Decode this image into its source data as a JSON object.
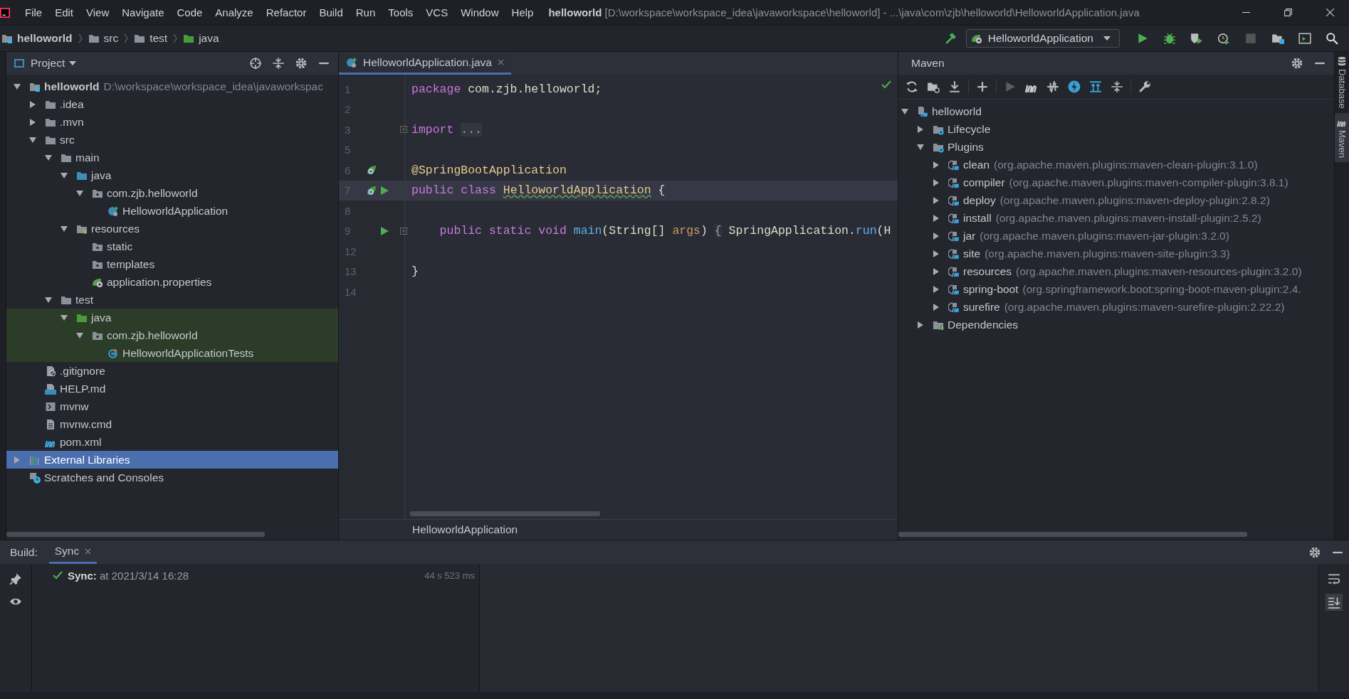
{
  "title_bar": {
    "menu": [
      "File",
      "Edit",
      "View",
      "Navigate",
      "Code",
      "Analyze",
      "Refactor",
      "Build",
      "Run",
      "Tools",
      "VCS",
      "Window",
      "Help"
    ],
    "title": "**helloworld** [D:\\workspace\\workspace_idea\\javaworkspace\\helloworld] - ...\\java\\com\\zjb\\helloworld\\HelloworldApplication.java"
  },
  "nav_bar": {
    "crumbs": [
      {
        "label": "helloworld",
        "kind": "module"
      },
      {
        "label": "src",
        "kind": "folder"
      },
      {
        "label": "test",
        "kind": "folder"
      },
      {
        "label": "java",
        "kind": "test-folder"
      }
    ],
    "run_config": "HelloworldApplication"
  },
  "project": {
    "title": "Project",
    "tree": [
      {
        "label": "helloworld",
        "detail": "D:\\workspace\\workspace_idea\\javaworkspac",
        "kind": "module",
        "expanded": true,
        "selected": false,
        "children": [
          {
            "label": ".idea",
            "kind": "folder",
            "expanded": false,
            "selected": false
          },
          {
            "label": ".mvn",
            "kind": "folder",
            "expanded": false,
            "selected": false
          },
          {
            "label": "src",
            "kind": "folder",
            "expanded": true,
            "selected": false,
            "children": [
              {
                "label": "main",
                "kind": "folder",
                "expanded": true,
                "selected": false,
                "children": [
                  {
                    "label": "java",
                    "kind": "source-folder",
                    "expanded": true,
                    "selected": false,
                    "children": [
                      {
                        "label": "com.zjb.helloworld",
                        "kind": "package",
                        "expanded": true,
                        "selected": false,
                        "children": [
                          {
                            "label": "HelloworldApplication",
                            "kind": "spring-class",
                            "selected": false
                          }
                        ]
                      }
                    ]
                  },
                  {
                    "label": "resources",
                    "kind": "resources-folder",
                    "expanded": true,
                    "selected": false,
                    "children": [
                      {
                        "label": "static",
                        "kind": "package",
                        "selected": false
                      },
                      {
                        "label": "templates",
                        "kind": "package",
                        "selected": false
                      },
                      {
                        "label": "application.properties",
                        "kind": "spring-config",
                        "selected": false
                      }
                    ]
                  }
                ]
              },
              {
                "label": "test",
                "kind": "folder",
                "expanded": true,
                "selected": false,
                "children": [
                  {
                    "label": "java",
                    "kind": "test-folder",
                    "expanded": true,
                    "selected": false,
                    "test_scope": true,
                    "children": [
                      {
                        "label": "com.zjb.helloworld",
                        "kind": "package",
                        "expanded": true,
                        "selected": false,
                        "children": [
                          {
                            "label": "HelloworldApplicationTests",
                            "kind": "test-class",
                            "selected": false
                          }
                        ]
                      }
                    ]
                  }
                ]
              }
            ]
          },
          {
            "label": ".gitignore",
            "kind": "ignore-file",
            "selected": false
          },
          {
            "label": "HELP.md",
            "kind": "markdown-file",
            "selected": false
          },
          {
            "label": "mvnw",
            "kind": "script-file",
            "selected": false
          },
          {
            "label": "mvnw.cmd",
            "kind": "text-file",
            "selected": false
          },
          {
            "label": "pom.xml",
            "kind": "maven-file",
            "selected": false
          }
        ]
      },
      {
        "label": "External Libraries",
        "kind": "libraries",
        "expanded": false,
        "selected": true
      },
      {
        "label": "Scratches and Consoles",
        "kind": "scratches",
        "selected": false
      }
    ]
  },
  "editor": {
    "tabs": [
      {
        "label": "HelloworldApplication.java",
        "selected": true
      }
    ],
    "lines": [
      {
        "number": "1",
        "current": false,
        "foldable": false,
        "spring_gutter": false,
        "run_button": false,
        "tokens": [
          {
            "text": "package",
            "kind": "keyword"
          },
          {
            "text": " com.zjb.helloworld;",
            "kind": "plain"
          }
        ]
      },
      {
        "number": "2",
        "current": false,
        "foldable": false,
        "spring_gutter": false,
        "run_button": false
      },
      {
        "number": "3",
        "current": false,
        "foldable": true,
        "spring_gutter": false,
        "run_button": false,
        "tokens": [
          {
            "text": "import ",
            "kind": "keyword"
          },
          {
            "text": "...",
            "kind": "folded"
          }
        ]
      },
      {
        "number": "5",
        "current": false,
        "foldable": false,
        "spring_gutter": false,
        "run_button": false
      },
      {
        "number": "6",
        "current": false,
        "foldable": false,
        "spring_gutter": true,
        "run_button": false,
        "tokens": [
          {
            "text": "@SpringBootApplication",
            "kind": "annotation"
          }
        ]
      },
      {
        "number": "7",
        "current": true,
        "foldable": false,
        "spring_gutter": true,
        "run_button": true,
        "tokens": [
          {
            "text": "public class ",
            "kind": "keyword"
          },
          {
            "text": "HelloworldApplication",
            "kind": "type",
            "warning": true
          },
          {
            "text": " {",
            "kind": "plain"
          }
        ]
      },
      {
        "number": "8",
        "current": false,
        "foldable": false,
        "spring_gutter": false,
        "run_button": false
      },
      {
        "number": "9",
        "current": false,
        "foldable": true,
        "spring_gutter": false,
        "run_button": true,
        "tokens": [
          {
            "text": "    public static void ",
            "kind": "keyword"
          },
          {
            "text": "main",
            "kind": "method"
          },
          {
            "text": "(String[] ",
            "kind": "plain"
          },
          {
            "text": "args",
            "kind": "param"
          },
          {
            "text": ") ",
            "kind": "plain"
          },
          {
            "text": "{",
            "kind": "brace"
          },
          {
            "text": " SpringApplication.",
            "kind": "plain"
          },
          {
            "text": "run",
            "kind": "method"
          },
          {
            "text": "(H",
            "kind": "plain"
          }
        ]
      },
      {
        "number": "12",
        "current": false,
        "foldable": false,
        "spring_gutter": false,
        "run_button": false
      },
      {
        "number": "13",
        "current": false,
        "foldable": false,
        "spring_gutter": false,
        "run_button": false,
        "tokens": [
          {
            "text": "}",
            "kind": "plain"
          }
        ]
      },
      {
        "number": "14",
        "current": false,
        "foldable": false,
        "spring_gutter": false,
        "run_button": false
      }
    ],
    "breadcrumb": "HelloworldApplication"
  },
  "maven": {
    "title": "Maven",
    "tree": [
      {
        "label": "helloworld",
        "kind": "maven-project",
        "expanded": true,
        "children": [
          {
            "label": "Lifecycle",
            "kind": "lifecycle",
            "expanded": false
          },
          {
            "label": "Plugins",
            "kind": "lifecycle",
            "expanded": true,
            "children": [
              {
                "label": "clean",
                "detail": "(org.apache.maven.plugins:maven-clean-plugin:3.1.0)",
                "kind": "plugin",
                "expanded": false
              },
              {
                "label": "compiler",
                "detail": "(org.apache.maven.plugins:maven-compiler-plugin:3.8.1)",
                "kind": "plugin",
                "expanded": false
              },
              {
                "label": "deploy",
                "detail": "(org.apache.maven.plugins:maven-deploy-plugin:2.8.2)",
                "kind": "plugin",
                "expanded": false
              },
              {
                "label": "install",
                "detail": "(org.apache.maven.plugins:maven-install-plugin:2.5.2)",
                "kind": "plugin",
                "expanded": false
              },
              {
                "label": "jar",
                "detail": "(org.apache.maven.plugins:maven-jar-plugin:3.2.0)",
                "kind": "plugin",
                "expanded": false
              },
              {
                "label": "site",
                "detail": "(org.apache.maven.plugins:maven-site-plugin:3.3)",
                "kind": "plugin",
                "expanded": false
              },
              {
                "label": "resources",
                "detail": "(org.apache.maven.plugins:maven-resources-plugin:3.2.0)",
                "kind": "plugin",
                "expanded": false
              },
              {
                "label": "spring-boot",
                "detail": "(org.springframework.boot:spring-boot-maven-plugin:2.4.",
                "kind": "plugin",
                "expanded": false
              },
              {
                "label": "surefire",
                "detail": "(org.apache.maven.plugins:maven-surefire-plugin:2.22.2)",
                "kind": "plugin",
                "expanded": false
              }
            ]
          },
          {
            "label": "Dependencies",
            "kind": "dependencies",
            "expanded": false
          }
        ]
      }
    ]
  },
  "build": {
    "label": "Build:",
    "tabs": [
      {
        "label": "Sync",
        "selected": true
      }
    ],
    "events": [
      {
        "text": "**Sync:** at 2021/3/14 16:28",
        "duration": "44 s 523 ms",
        "success": true
      }
    ]
  },
  "side_tabs": [
    {
      "label": "Database",
      "kind": "database",
      "selected": false
    },
    {
      "label": "Maven",
      "kind": "maven",
      "selected": true
    }
  ]
}
